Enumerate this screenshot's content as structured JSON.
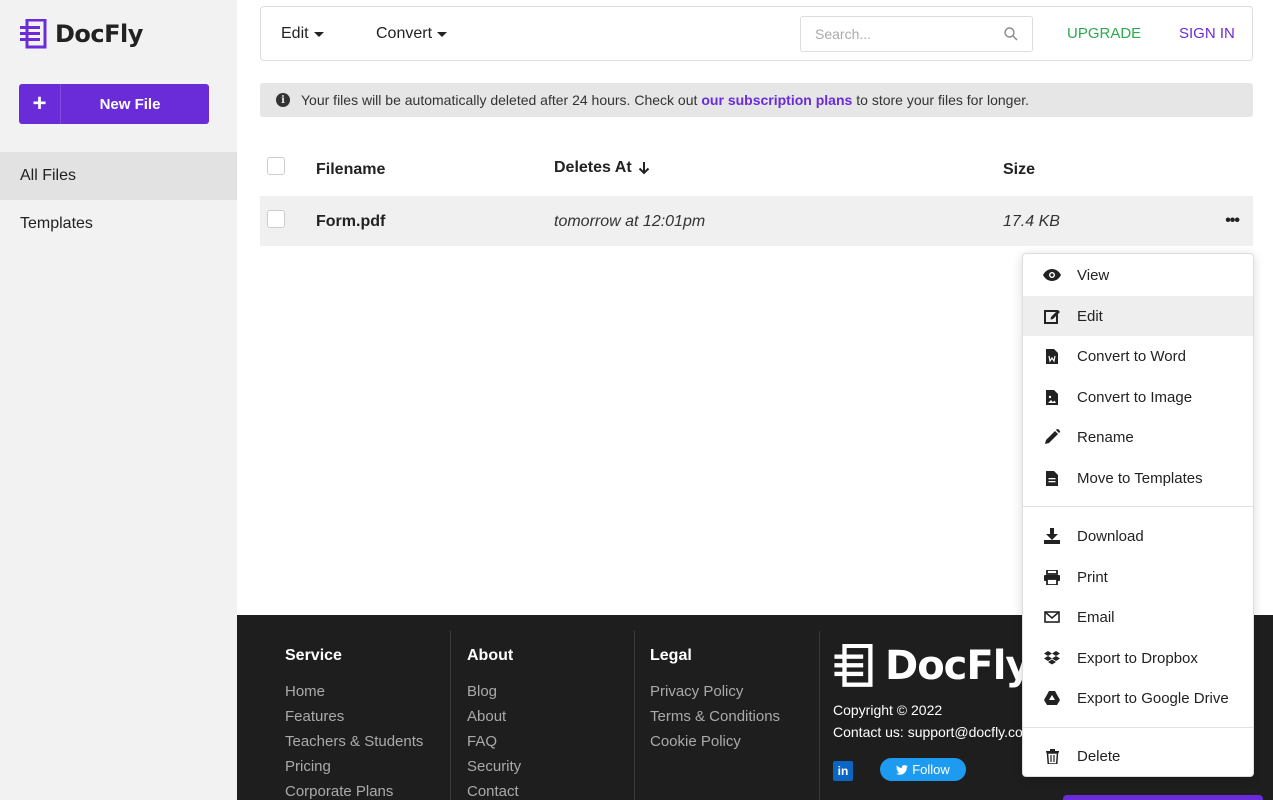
{
  "app": {
    "name": "DocFly"
  },
  "sidebar": {
    "new_file_label": "New File",
    "items": [
      {
        "label": "All Files",
        "active": true
      },
      {
        "label": "Templates",
        "active": false
      }
    ]
  },
  "toolbar": {
    "edit_label": "Edit",
    "convert_label": "Convert",
    "search_placeholder": "Search...",
    "upgrade_label": "UPGRADE",
    "signin_label": "SIGN IN"
  },
  "notice": {
    "prefix": "Your files will be automatically deleted after 24 hours. Check out",
    "link": "our subscription plans",
    "suffix": "to store your files for longer."
  },
  "table": {
    "headers": {
      "filename": "Filename",
      "deletes_at": "Deletes At",
      "size": "Size"
    },
    "rows": [
      {
        "filename": "Form.pdf",
        "deletes_at": "tomorrow at 12:01pm",
        "size": "17.4 KB"
      }
    ]
  },
  "context_menu": {
    "items": [
      {
        "label": "View",
        "icon": "eye-icon"
      },
      {
        "label": "Edit",
        "icon": "edit-icon"
      },
      {
        "label": "Convert to Word",
        "icon": "word-file-icon"
      },
      {
        "label": "Convert to Image",
        "icon": "image-file-icon"
      },
      {
        "label": "Rename",
        "icon": "pencil-icon"
      },
      {
        "label": "Move to Templates",
        "icon": "file-icon"
      },
      {
        "label": "Download",
        "icon": "download-icon"
      },
      {
        "label": "Print",
        "icon": "print-icon"
      },
      {
        "label": "Email",
        "icon": "envelope-icon"
      },
      {
        "label": "Export to Dropbox",
        "icon": "dropbox-icon"
      },
      {
        "label": "Export to Google Drive",
        "icon": "google-drive-icon"
      },
      {
        "label": "Delete",
        "icon": "trash-icon"
      }
    ]
  },
  "footer": {
    "service": {
      "title": "Service",
      "links": [
        "Home",
        "Features",
        "Teachers & Students",
        "Pricing",
        "Corporate Plans"
      ]
    },
    "about": {
      "title": "About",
      "links": [
        "Blog",
        "About",
        "FAQ",
        "Security",
        "Contact"
      ]
    },
    "legal": {
      "title": "Legal",
      "links": [
        "Privacy Policy",
        "Terms & Conditions",
        "Cookie Policy"
      ]
    },
    "logo_text": "DocFly",
    "copyright": "Copyright © 2022",
    "contact": "Contact us: support@docfly.com",
    "linkedin_label": "in",
    "follow_label": "Follow"
  },
  "colors": {
    "brand": "#6a2bd9",
    "upgrade": "#2fa84f",
    "footer_bg": "#1e1e1e"
  }
}
